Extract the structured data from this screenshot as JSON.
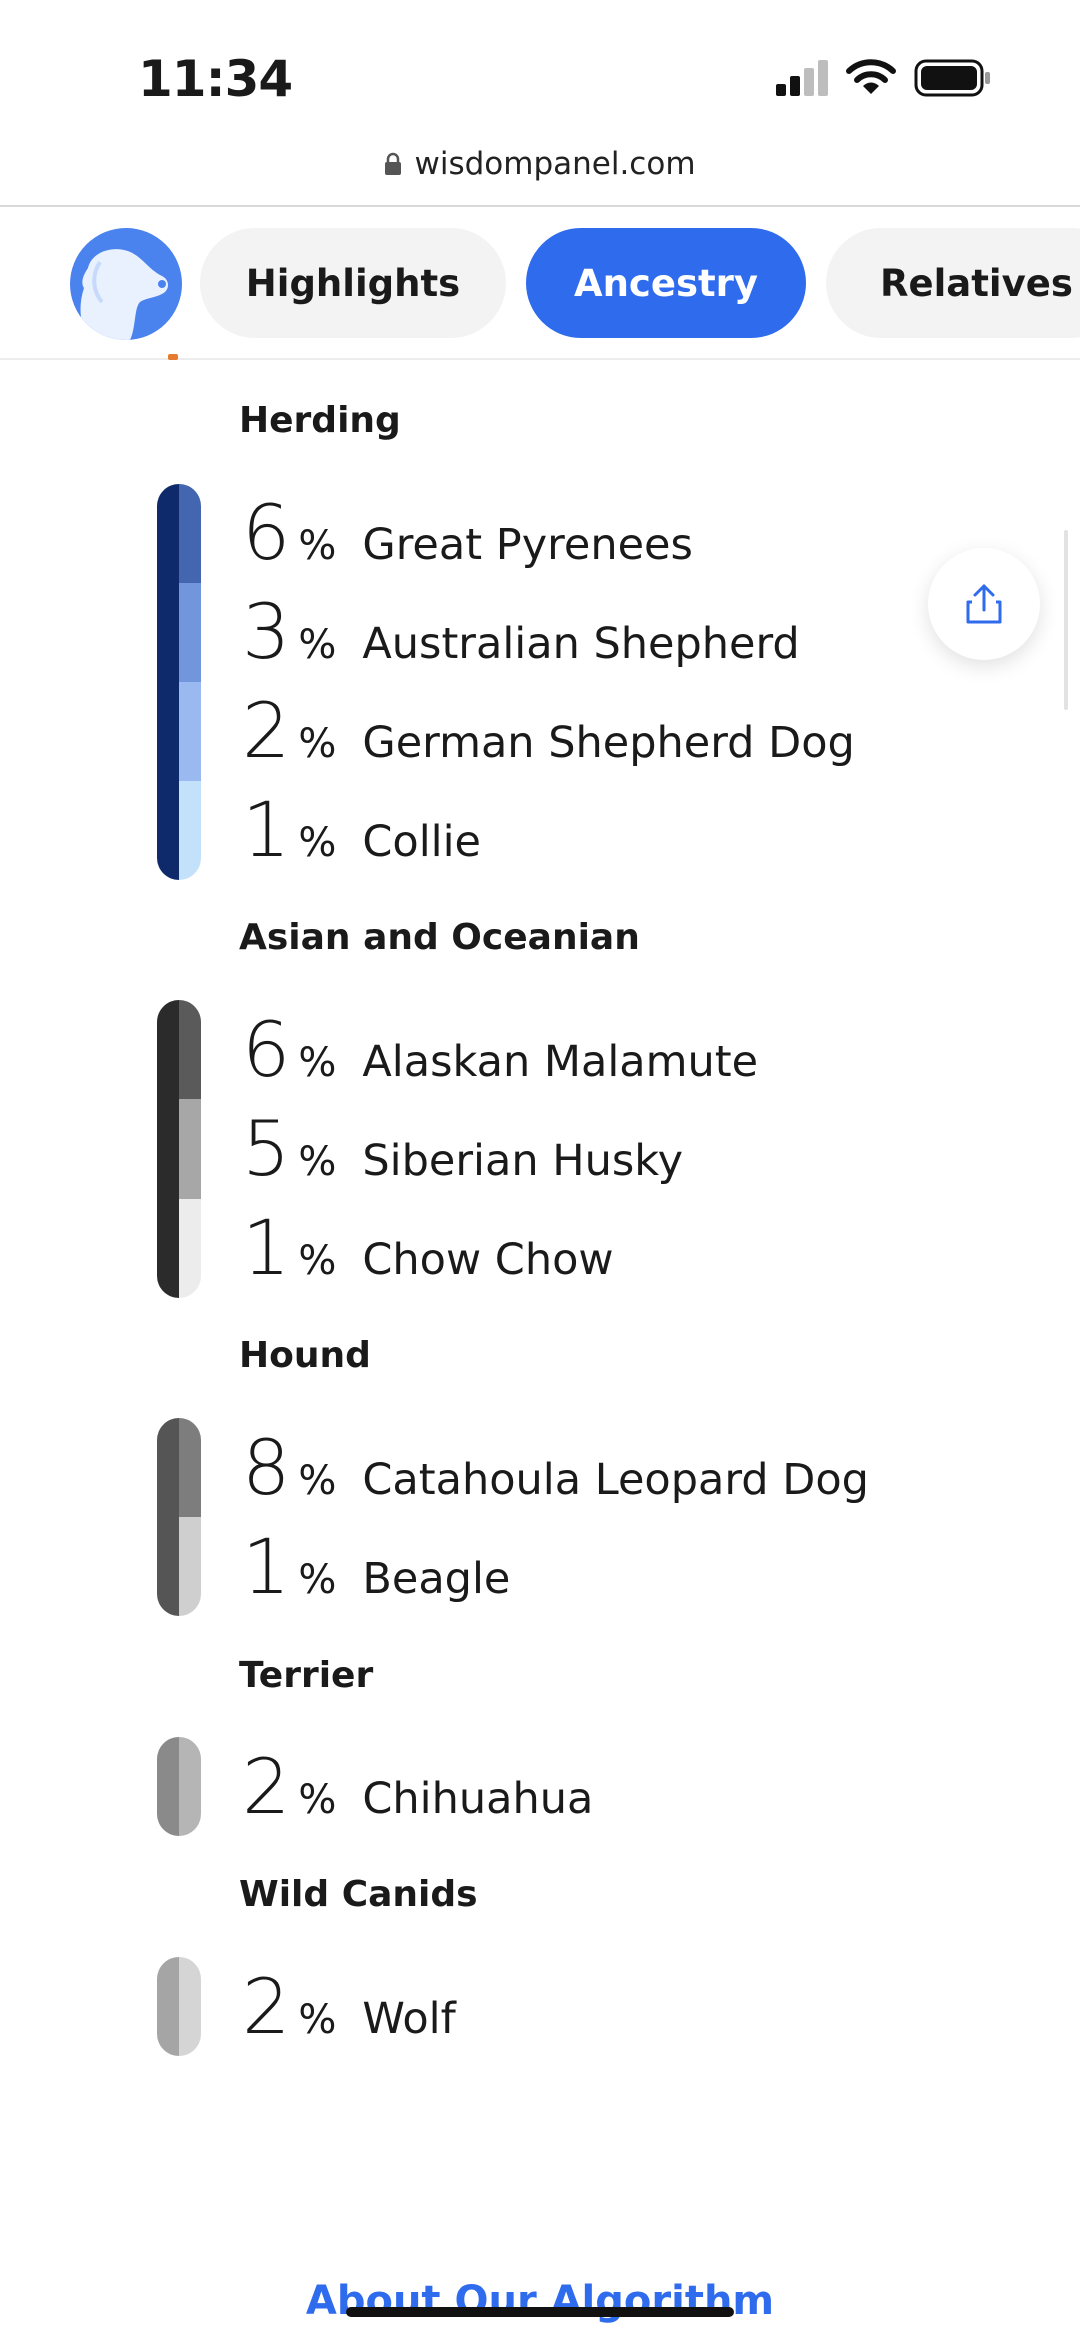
{
  "status_bar": {
    "time": "11:34"
  },
  "url_bar": {
    "domain": "wisdompanel.com"
  },
  "tabs": [
    {
      "label": "Highlights",
      "active": false
    },
    {
      "label": "Ancestry",
      "active": true
    },
    {
      "label": "Relatives",
      "active": false
    }
  ],
  "colors": {
    "accent": "#2f6bed",
    "avatar": "#4b83ee"
  },
  "groups": [
    {
      "title": "Herding",
      "items": [
        {
          "pct": "6",
          "breed": "Great Pyrenees",
          "color": "#4466b0"
        },
        {
          "pct": "3",
          "breed": "Australian Shepherd",
          "color": "#7296dc"
        },
        {
          "pct": "2",
          "breed": "German Shepherd Dog",
          "color": "#9bb9f1"
        },
        {
          "pct": "1",
          "breed": "Collie",
          "color": "#c4e1fb"
        }
      ]
    },
    {
      "title": "Asian and Oceanian",
      "items": [
        {
          "pct": "6",
          "breed": "Alaskan Malamute",
          "color": "#5a5a5a"
        },
        {
          "pct": "5",
          "breed": "Siberian Husky",
          "color": "#a7a7a7"
        },
        {
          "pct": "1",
          "breed": "Chow Chow",
          "color": "#ececec"
        }
      ]
    },
    {
      "title": "Hound",
      "items": [
        {
          "pct": "8",
          "breed": "Catahoula Leopard Dog",
          "color": "#7d7d7d"
        },
        {
          "pct": "1",
          "breed": "Beagle",
          "color": "#cfcfcf"
        }
      ]
    },
    {
      "title": "Terrier",
      "items": [
        {
          "pct": "2",
          "breed": "Chihuahua",
          "color": "#b5b5b5"
        }
      ]
    },
    {
      "title": "Wild Canids",
      "items": [
        {
          "pct": "2",
          "breed": "Wolf",
          "color": "#d5d5d5"
        }
      ]
    }
  ],
  "footer": {
    "link": "About Our Algorithm"
  },
  "icons": [
    "lock-icon",
    "dog-avatar-icon",
    "share-icon",
    "signal-icon",
    "wifi-icon",
    "battery-icon"
  ]
}
